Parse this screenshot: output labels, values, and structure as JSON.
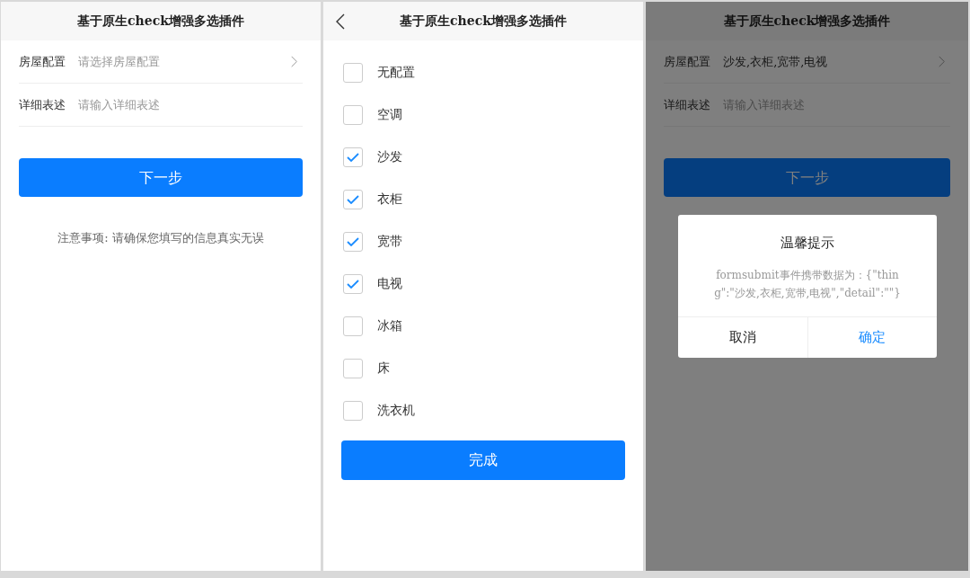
{
  "screens": [
    {
      "kind": "form",
      "header": {
        "title": "基于原生check增强多选插件",
        "back": false
      },
      "fields": [
        {
          "label": "房屋配置",
          "placeholder": "请选择房屋配置",
          "chevron": true
        },
        {
          "label": "详细表述",
          "placeholder": "请输入详细表述",
          "chevron": false
        }
      ],
      "button": "下一步",
      "note": "注意事项: 请确保您填写的信息真实无误"
    },
    {
      "kind": "checklist",
      "header": {
        "title": "基于原生check增强多选插件",
        "back": true
      },
      "options": [
        {
          "label": "无配置",
          "checked": false
        },
        {
          "label": "空调",
          "checked": false
        },
        {
          "label": "沙发",
          "checked": true
        },
        {
          "label": "衣柜",
          "checked": true
        },
        {
          "label": "宽带",
          "checked": true
        },
        {
          "label": "电视",
          "checked": true
        },
        {
          "label": "冰箱",
          "checked": false
        },
        {
          "label": "床",
          "checked": false
        },
        {
          "label": "洗衣机",
          "checked": false
        }
      ],
      "button": "完成"
    },
    {
      "kind": "dialog",
      "header": {
        "title": "基于原生check增强多选插件",
        "back": false
      },
      "fields": [
        {
          "label": "房屋配置",
          "value": "沙发,衣柜,宽带,电视",
          "chevron": true
        },
        {
          "label": "详细表述",
          "placeholder": "请输入详细表述",
          "chevron": false
        }
      ],
      "button": "下一步",
      "dialog": {
        "title": "温馨提示",
        "message": "formsubmit事件携带数据为：{\"thing\":\"沙发,衣柜,宽带,电视\",\"detail\":\"\"}",
        "cancel": "取消",
        "confirm": "确定"
      }
    }
  ]
}
